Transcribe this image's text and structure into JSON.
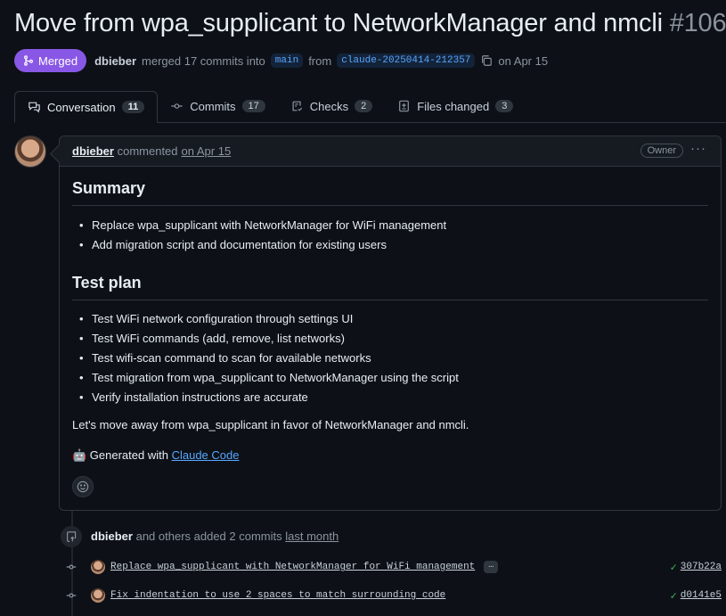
{
  "pr": {
    "title": "Move from wpa_supplicant to NetworkManager and nmcli",
    "number": "#106",
    "state": "Merged",
    "author": "dbieber",
    "merge_text": "merged 17 commits into",
    "base_branch": "main",
    "from_text": "from",
    "head_branch": "claude-20250414-212357",
    "date_text": "on Apr 15"
  },
  "tabs": [
    {
      "label": "Conversation",
      "count": "11"
    },
    {
      "label": "Commits",
      "count": "17"
    },
    {
      "label": "Checks",
      "count": "2"
    },
    {
      "label": "Files changed",
      "count": "3"
    }
  ],
  "comment": {
    "author": "dbieber",
    "action": "commented",
    "date": "on Apr 15",
    "role": "Owner",
    "menu": "···",
    "summary_heading": "Summary",
    "summary_items": [
      "Replace wpa_supplicant with NetworkManager for WiFi management",
      "Add migration script and documentation for existing users"
    ],
    "test_heading": "Test plan",
    "test_items": [
      "Test WiFi network configuration through settings UI",
      "Test WiFi commands (add, remove, list networks)",
      "Test wifi-scan command to scan for available networks",
      "Test migration from wpa_supplicant to NetworkManager using the script",
      "Verify installation instructions are accurate"
    ],
    "paragraph": "Let's move away from wpa_supplicant in favor of NetworkManager and nmcli.",
    "generated_prefix": "🤖 Generated with",
    "generated_link": "Claude Code"
  },
  "event": {
    "author": "dbieber",
    "text": "and others added 2 commits",
    "when": "last month"
  },
  "commits": [
    {
      "message": "Replace wpa_supplicant with NetworkManager for WiFi management",
      "more": "…",
      "sha": "307b22a"
    },
    {
      "message": "Fix indentation to use 2 spaces to match surrounding code",
      "sha": "d0141e5"
    }
  ],
  "colors": {
    "merged": "#8957e5",
    "link": "#58a6ff",
    "success": "#3fb950",
    "background": "#0d1117"
  },
  "icons": {
    "merge": "git-merge-icon",
    "copy": "copy-icon",
    "conversation": "comment-discussion-icon",
    "commits": "git-commit-icon",
    "checks": "checklist-icon",
    "files": "file-diff-icon",
    "emoji": "smiley-icon",
    "event": "repo-push-icon",
    "check": "check-icon"
  }
}
